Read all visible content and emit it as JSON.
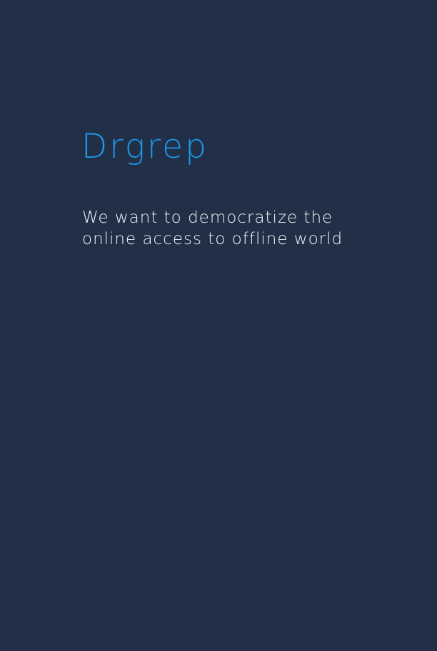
{
  "brand": {
    "name": "Drgrep",
    "color": "#1e96e8"
  },
  "tagline": {
    "line1": "We want to democratize the",
    "line2": "online access to offline world",
    "color": "#f2f4f7"
  },
  "theme": {
    "background": "#213047"
  }
}
